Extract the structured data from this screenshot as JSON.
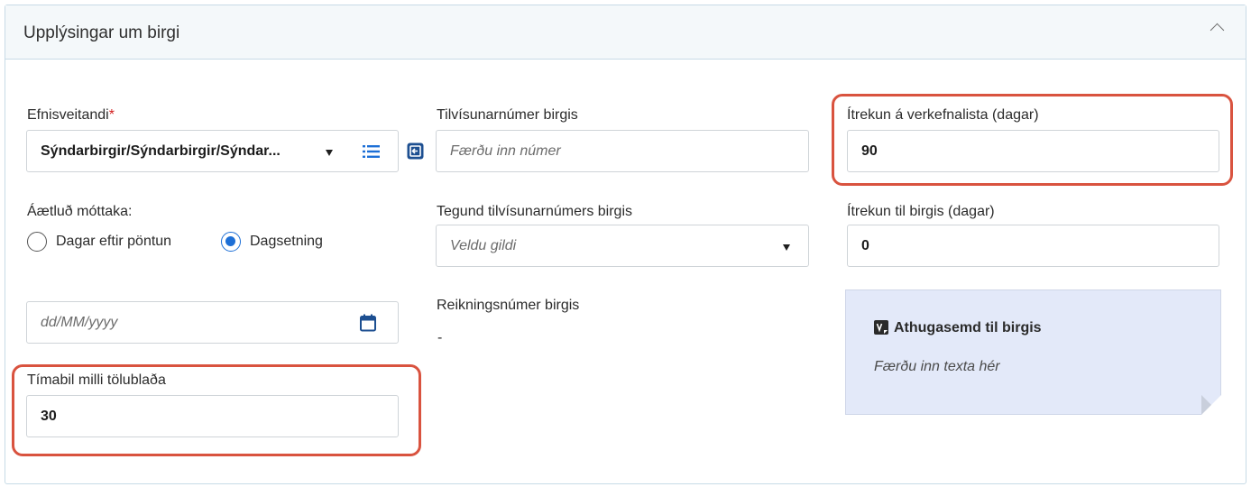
{
  "section": {
    "title": "Upplýsingar um birgi",
    "collapse_icon": "chevron-up-icon"
  },
  "efnisveitandi": {
    "label": "Efnisveitandi",
    "required_mark": "*",
    "value": "Sýndarbirgir/Sýndarbirgir/Sýndar...",
    "list_icon": "list-icon",
    "action_icon": "open-in-icon"
  },
  "tilvisunarnumer": {
    "label": "Tilvísunarnúmer birgis",
    "placeholder": "Færðu inn númer"
  },
  "itrekun_verkefnalista": {
    "label": "Ítrekun á verkefnalista (dagar)",
    "value": "90"
  },
  "aetlud_mottaka": {
    "label": "Áætluð móttaka:",
    "options": [
      "Dagar eftir pöntun",
      "Dagsetning"
    ],
    "selected": "Dagsetning"
  },
  "tegund": {
    "label": "Tegund tilvísunarnúmers birgis",
    "placeholder": "Veldu gildi"
  },
  "itrekun_birgis": {
    "label": "Ítrekun til birgis (dagar)",
    "value": "0"
  },
  "date": {
    "placeholder": "dd/MM/yyyy",
    "icon": "calendar-icon"
  },
  "reikningsnumer": {
    "label": "Reikningsnúmer birgis",
    "value": "-"
  },
  "note": {
    "title": "Athugasemd til birgis",
    "placeholder": "Færðu inn texta hér",
    "icon": "note-icon"
  },
  "timabil": {
    "label": "Tímabil milli tölublaða",
    "value": "30"
  },
  "colors": {
    "highlight": "#d9533f",
    "accent": "#1d6fd6",
    "required": "#d21f1f",
    "note_bg": "#e3e9f9"
  }
}
